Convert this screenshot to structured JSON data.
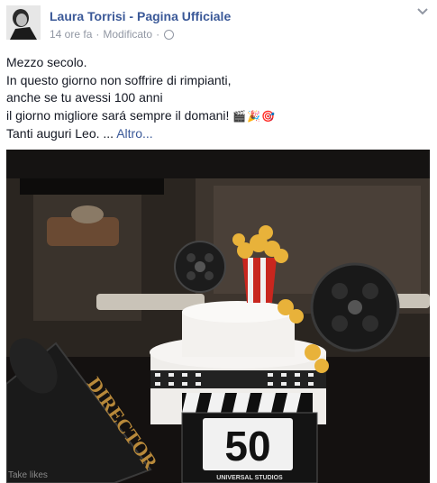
{
  "post": {
    "author": "Laura Torrisi - Pagina Ufficiale",
    "time": "14 ore fa",
    "separator": "·",
    "edited": "Modificato",
    "lines": [
      "Mezzo secolo.",
      "In questo giorno non soffrire di rimpianti,",
      "anche se tu avessi 100 anni",
      "il giorno migliore sará sempre il domani!"
    ],
    "emoji": "🎬🎉🎯",
    "last_line": "Tanti auguri Leo. ...",
    "more_link": "Altro..."
  },
  "photo": {
    "cake_number": "50",
    "clapper_caption": "UNIVERSAL STUDIOS",
    "megaphone_text": "DIRECTOR",
    "watermark": "Take likes"
  },
  "colors": {
    "link": "#3b5998",
    "meta": "#9197a3",
    "text": "#141823"
  }
}
